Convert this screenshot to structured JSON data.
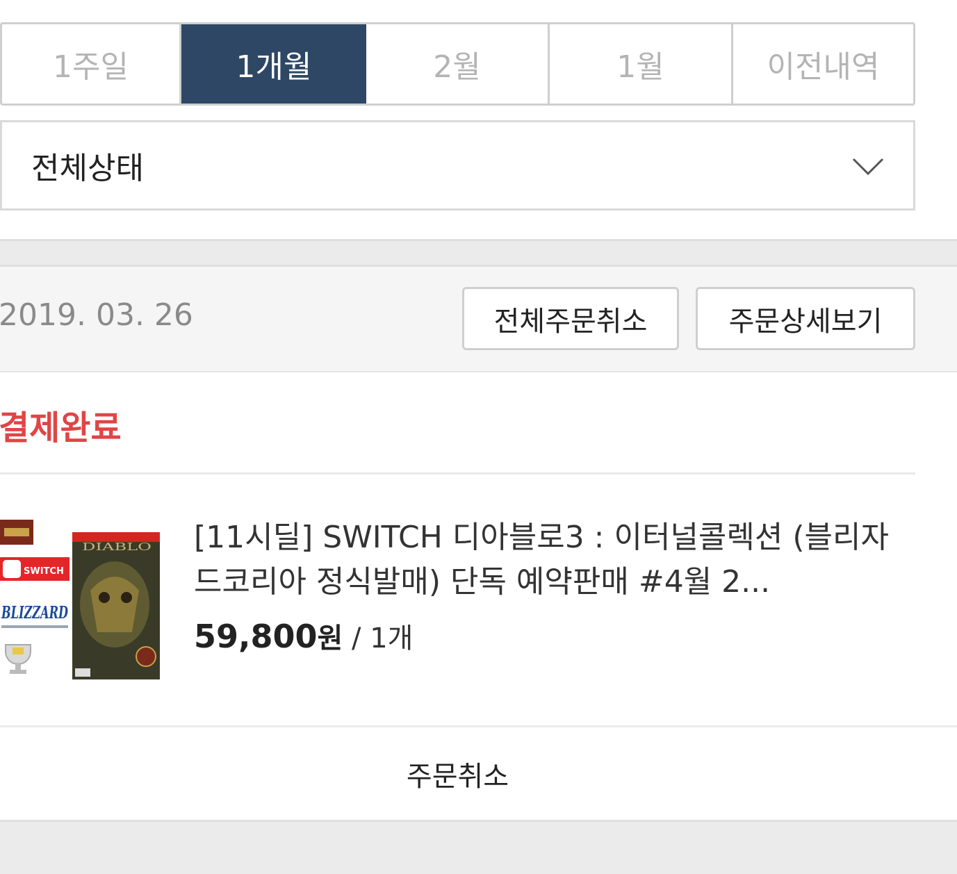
{
  "period_tabs": [
    {
      "label": "1주일",
      "active": false
    },
    {
      "label": "1개월",
      "active": true
    },
    {
      "label": "2월",
      "active": false
    },
    {
      "label": "1월",
      "active": false
    },
    {
      "label": "이전내역",
      "active": false
    }
  ],
  "status_filter": {
    "value": "전체상태",
    "icon": "chevron-down-icon"
  },
  "order": {
    "date": "2019. 03. 26",
    "cancel_all_label": "전체주문취소",
    "detail_label": "주문상세보기",
    "status": "결제완료",
    "product": {
      "name": "[11시딜] SWITCH 디아블로3 : 이터널콜렉션 (블리자드코리아 정식발매) 단독 예약판매 #4월 2...",
      "price": "59,800",
      "currency": "원",
      "separator": " / ",
      "quantity": "1개",
      "thumbnail_labels": {
        "switch": "SWITCH",
        "blizzard": "BLIZZARD",
        "game": "DIABLO"
      }
    },
    "cancel_label": "주문취소"
  },
  "colors": {
    "active_tab": "#2e4765",
    "status_red": "#e04545",
    "band": "#ebebeb"
  }
}
